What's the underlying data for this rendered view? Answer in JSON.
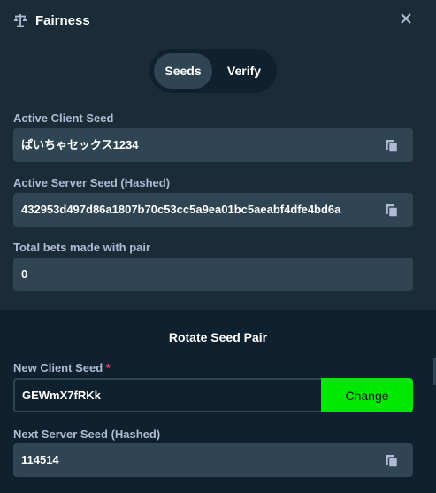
{
  "header": {
    "title": "Fairness",
    "icon": "scale-icon"
  },
  "tabs": [
    {
      "label": "Seeds",
      "active": true
    },
    {
      "label": "Verify",
      "active": false
    }
  ],
  "client_seed": {
    "label": "Active Client Seed",
    "value": "ぱいちゃセックス1234"
  },
  "server_seed": {
    "label": "Active Server Seed (Hashed)",
    "value": "432953d497d86a1807b70c53cc5a9ea01bc5aeabf4dfe4bd6a"
  },
  "total_bets": {
    "label": "Total bets made with pair",
    "value": "0"
  },
  "rotate": {
    "title": "Rotate Seed Pair",
    "new_client_label": "New Client Seed",
    "required_mark": "*",
    "new_client_value": "GEWmX7fRKk",
    "change_label": "Change",
    "next_server_label": "Next Server Seed (Hashed)",
    "next_server_value": "114514"
  },
  "colors": {
    "background": "#1a2c38",
    "panel_dark": "#0f212e",
    "field": "#2f4553",
    "accent_green": "#00e701",
    "label": "#b1bad3"
  }
}
